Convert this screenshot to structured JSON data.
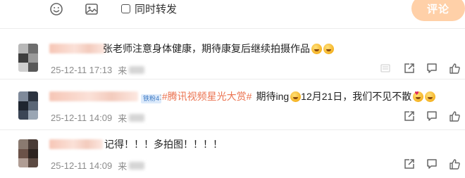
{
  "toolbar": {
    "emoji_icon": "emoji-smile-icon",
    "image_icon": "image-icon",
    "repost_label": "同时转发",
    "submit_label": "评论"
  },
  "colors": {
    "accent": "#eb7350",
    "submit_disabled": "#ffd0a8",
    "meta_text": "#8c8c8c",
    "badge_bg": "#dceafb",
    "badge_text": "#3a78c3"
  },
  "comments": [
    {
      "text": "张老师注意身体健康，期待康复后继续拍摄作品",
      "emojis": [
        "sob-emoji",
        "sob-emoji"
      ],
      "timestamp": "25-12-11 17:13",
      "location_prefix": "来"
    },
    {
      "badge": "铁粉4",
      "topic": "#腾讯视频星光大赏#",
      "text": "期待ing",
      "text_after": "12月21日，我们不见不散",
      "emojis": [
        "sob-emoji",
        "heart-emoji",
        "sob-emoji"
      ],
      "timestamp": "25-12-11 14:09",
      "location_prefix": "来"
    },
    {
      "text": "记得！！！多拍图！！！！",
      "timestamp": "25-12-11 14:09",
      "location_prefix": "来"
    }
  ],
  "action_icons": [
    "hide-icon",
    "share-icon",
    "comment-icon",
    "like-icon"
  ]
}
